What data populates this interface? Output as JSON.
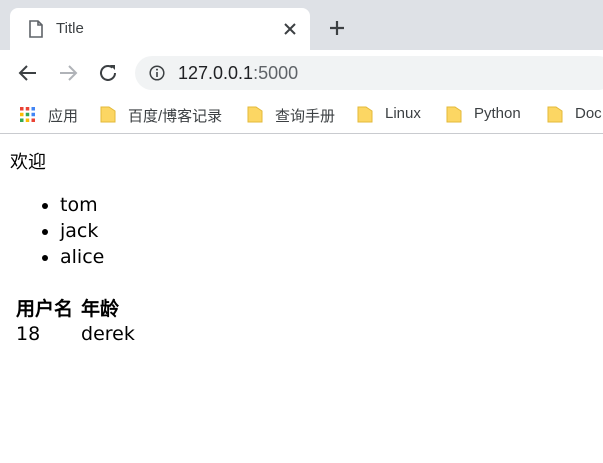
{
  "tab": {
    "title": "Title"
  },
  "address": {
    "host": "127.0.0.1",
    "port": ":5000"
  },
  "bookmarks": [
    {
      "label": "应用",
      "icon": "apps-icon"
    },
    {
      "label": "百度/博客记录",
      "icon": "folder-icon"
    },
    {
      "label": "查询手册",
      "icon": "folder-icon"
    },
    {
      "label": "Linux",
      "icon": "folder-icon"
    },
    {
      "label": "Python",
      "icon": "folder-icon"
    },
    {
      "label": "Doc",
      "icon": "folder-icon"
    }
  ],
  "page": {
    "welcome": "欢迎",
    "users": [
      "tom",
      "jack",
      "alice"
    ],
    "table": {
      "headers": [
        "用户名",
        "年龄"
      ],
      "rows": [
        [
          "18",
          "derek"
        ]
      ]
    }
  },
  "colors": {
    "tabstrip": "#dee1e6",
    "folder": "#fcd663",
    "omnibox": "#f1f3f4"
  }
}
